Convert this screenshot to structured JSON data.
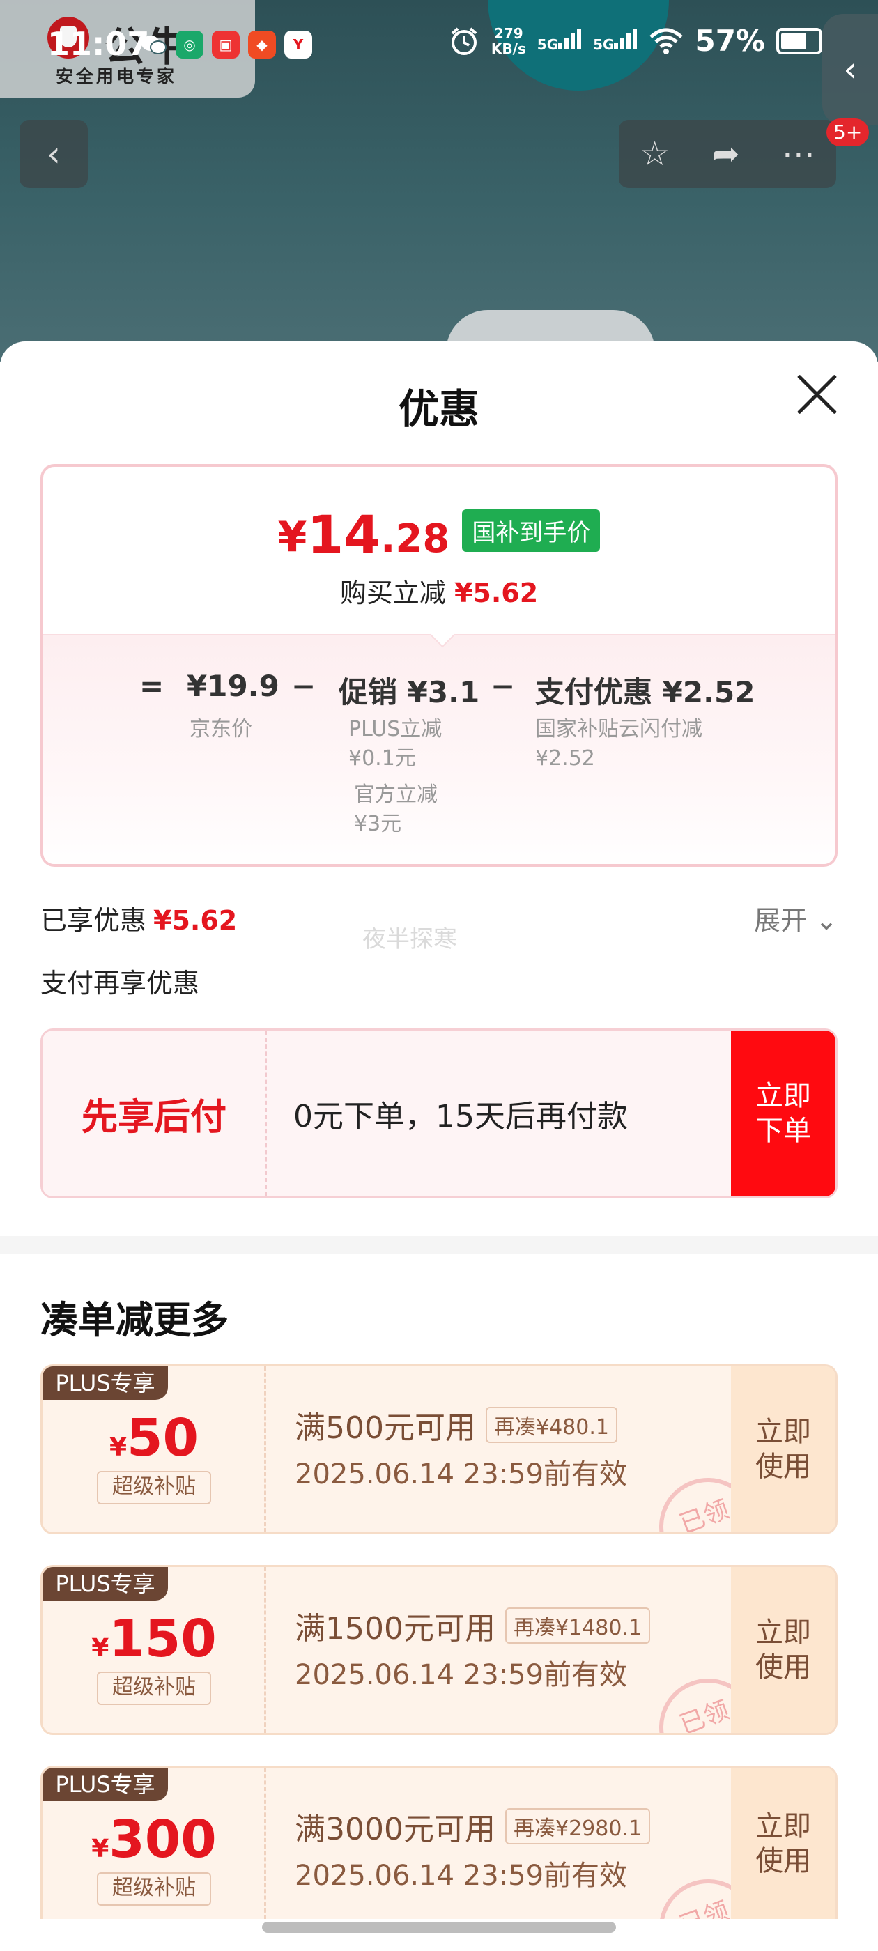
{
  "status_bar": {
    "time": "11:07",
    "speed_top": "279",
    "speed_unit": "KB/s",
    "sig1": "5G",
    "sig2": "5G",
    "battery": "57%"
  },
  "brand": {
    "name": "公牛",
    "subtitle": "安全用电专家"
  },
  "nav": {
    "notification_count": "5+"
  },
  "sheet": {
    "title": "优惠",
    "price": {
      "yen": "¥",
      "integer": "14",
      "decimal": ".28",
      "tag": "国补到手价",
      "sub_label": "购买立减",
      "sub_value": "¥5.62"
    },
    "formula": {
      "equals": "=",
      "jd_price": "¥19.9",
      "jd_label": "京东价",
      "minus1": "−",
      "promo": "促销 ¥3.1",
      "promo_detail1_a": "PLUS立减",
      "promo_detail1_b": "¥0.1元",
      "promo_detail2_a": "官方立减",
      "promo_detail2_b": "¥3元",
      "minus2": "−",
      "pay": "支付优惠 ¥2.52",
      "pay_detail_a": "国家补贴云闪付减",
      "pay_detail_b": "¥2.52"
    },
    "enjoyed_label": "已享优惠",
    "enjoyed_value": "¥5.62",
    "expand_label": "展开",
    "watermark": "夜半探寒",
    "pay_more_label": "支付再享优惠",
    "bnpl": {
      "title": "先享后付",
      "text": "0元下单，15天后再付款",
      "button": "立即下单"
    },
    "section_title": "凑单减更多",
    "coupons": [
      {
        "tag": "PLUS专享",
        "yen": "¥",
        "amount": "50",
        "sub": "超级补贴",
        "condition": "满500元可用",
        "chip": "再凑¥480.1",
        "date": "2025.06.14 23:59前有效",
        "button": "立即使用",
        "stamp": "已领"
      },
      {
        "tag": "PLUS专享",
        "yen": "¥",
        "amount": "150",
        "sub": "超级补贴",
        "condition": "满1500元可用",
        "chip": "再凑¥1480.1",
        "date": "2025.06.14 23:59前有效",
        "button": "立即使用",
        "stamp": "已领"
      },
      {
        "tag": "PLUS专享",
        "yen": "¥",
        "amount": "300",
        "sub": "超级补贴",
        "condition": "满3000元可用",
        "chip": "再凑¥2980.1",
        "date": "2025.06.14 23:59前有效",
        "button": "立即使用",
        "stamp": "已领"
      }
    ]
  }
}
